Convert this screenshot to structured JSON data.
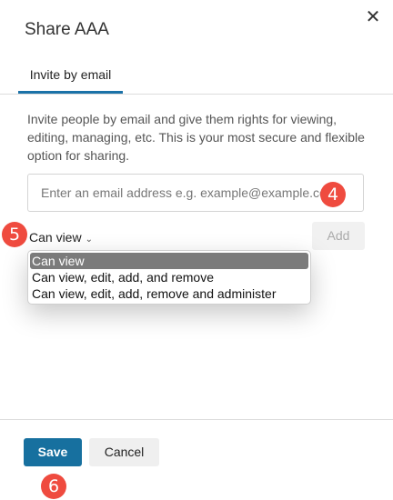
{
  "dialog": {
    "title": "Share AAA",
    "close_icon": "close-icon",
    "close_glyph": "✕"
  },
  "tabs": [
    {
      "label": "Invite by email",
      "active": true
    }
  ],
  "description": "Invite people by email and give them rights for viewing, editing, managing, etc. This is your most secure and flexible option for sharing.",
  "email": {
    "value": "",
    "placeholder": "Enter an email address e.g. example@example.co"
  },
  "permission": {
    "selected": "Can view",
    "chevron_icon": "chevron-down-icon",
    "chevron_glyph": "⌄",
    "options": [
      "Can view",
      "Can view, edit, add, and remove",
      "Can view, edit, add, remove and administer"
    ]
  },
  "buttons": {
    "add": "Add",
    "save": "Save",
    "cancel": "Cancel"
  },
  "markers": [
    "4",
    "5",
    "6"
  ],
  "colors": {
    "accent": "#17709f",
    "tab_underline": "#1b72a8",
    "marker": "#ef4b3f",
    "selected_option": "#7b7b7b"
  }
}
